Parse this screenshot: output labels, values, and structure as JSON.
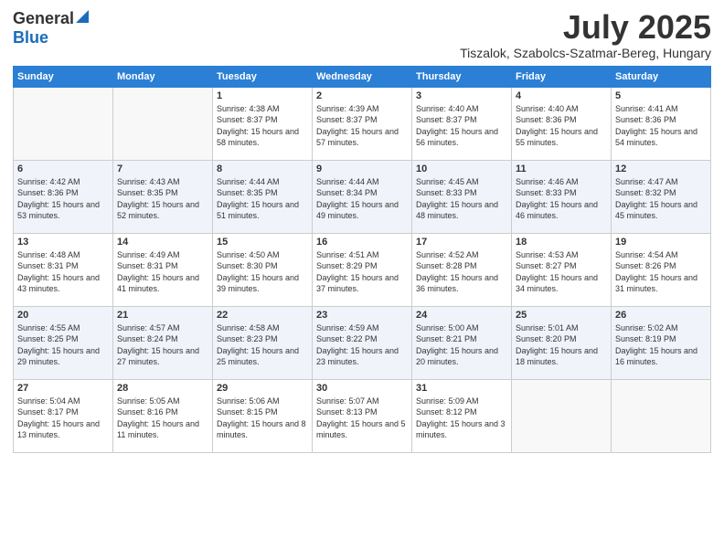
{
  "logo": {
    "general": "General",
    "blue": "Blue"
  },
  "title": "July 2025",
  "subtitle": "Tiszalok, Szabolcs-Szatmar-Bereg, Hungary",
  "headers": [
    "Sunday",
    "Monday",
    "Tuesday",
    "Wednesday",
    "Thursday",
    "Friday",
    "Saturday"
  ],
  "weeks": [
    [
      {
        "day": "",
        "info": ""
      },
      {
        "day": "",
        "info": ""
      },
      {
        "day": "1",
        "info": "Sunrise: 4:38 AM\nSunset: 8:37 PM\nDaylight: 15 hours and 58 minutes."
      },
      {
        "day": "2",
        "info": "Sunrise: 4:39 AM\nSunset: 8:37 PM\nDaylight: 15 hours and 57 minutes."
      },
      {
        "day": "3",
        "info": "Sunrise: 4:40 AM\nSunset: 8:37 PM\nDaylight: 15 hours and 56 minutes."
      },
      {
        "day": "4",
        "info": "Sunrise: 4:40 AM\nSunset: 8:36 PM\nDaylight: 15 hours and 55 minutes."
      },
      {
        "day": "5",
        "info": "Sunrise: 4:41 AM\nSunset: 8:36 PM\nDaylight: 15 hours and 54 minutes."
      }
    ],
    [
      {
        "day": "6",
        "info": "Sunrise: 4:42 AM\nSunset: 8:36 PM\nDaylight: 15 hours and 53 minutes."
      },
      {
        "day": "7",
        "info": "Sunrise: 4:43 AM\nSunset: 8:35 PM\nDaylight: 15 hours and 52 minutes."
      },
      {
        "day": "8",
        "info": "Sunrise: 4:44 AM\nSunset: 8:35 PM\nDaylight: 15 hours and 51 minutes."
      },
      {
        "day": "9",
        "info": "Sunrise: 4:44 AM\nSunset: 8:34 PM\nDaylight: 15 hours and 49 minutes."
      },
      {
        "day": "10",
        "info": "Sunrise: 4:45 AM\nSunset: 8:33 PM\nDaylight: 15 hours and 48 minutes."
      },
      {
        "day": "11",
        "info": "Sunrise: 4:46 AM\nSunset: 8:33 PM\nDaylight: 15 hours and 46 minutes."
      },
      {
        "day": "12",
        "info": "Sunrise: 4:47 AM\nSunset: 8:32 PM\nDaylight: 15 hours and 45 minutes."
      }
    ],
    [
      {
        "day": "13",
        "info": "Sunrise: 4:48 AM\nSunset: 8:31 PM\nDaylight: 15 hours and 43 minutes."
      },
      {
        "day": "14",
        "info": "Sunrise: 4:49 AM\nSunset: 8:31 PM\nDaylight: 15 hours and 41 minutes."
      },
      {
        "day": "15",
        "info": "Sunrise: 4:50 AM\nSunset: 8:30 PM\nDaylight: 15 hours and 39 minutes."
      },
      {
        "day": "16",
        "info": "Sunrise: 4:51 AM\nSunset: 8:29 PM\nDaylight: 15 hours and 37 minutes."
      },
      {
        "day": "17",
        "info": "Sunrise: 4:52 AM\nSunset: 8:28 PM\nDaylight: 15 hours and 36 minutes."
      },
      {
        "day": "18",
        "info": "Sunrise: 4:53 AM\nSunset: 8:27 PM\nDaylight: 15 hours and 34 minutes."
      },
      {
        "day": "19",
        "info": "Sunrise: 4:54 AM\nSunset: 8:26 PM\nDaylight: 15 hours and 31 minutes."
      }
    ],
    [
      {
        "day": "20",
        "info": "Sunrise: 4:55 AM\nSunset: 8:25 PM\nDaylight: 15 hours and 29 minutes."
      },
      {
        "day": "21",
        "info": "Sunrise: 4:57 AM\nSunset: 8:24 PM\nDaylight: 15 hours and 27 minutes."
      },
      {
        "day": "22",
        "info": "Sunrise: 4:58 AM\nSunset: 8:23 PM\nDaylight: 15 hours and 25 minutes."
      },
      {
        "day": "23",
        "info": "Sunrise: 4:59 AM\nSunset: 8:22 PM\nDaylight: 15 hours and 23 minutes."
      },
      {
        "day": "24",
        "info": "Sunrise: 5:00 AM\nSunset: 8:21 PM\nDaylight: 15 hours and 20 minutes."
      },
      {
        "day": "25",
        "info": "Sunrise: 5:01 AM\nSunset: 8:20 PM\nDaylight: 15 hours and 18 minutes."
      },
      {
        "day": "26",
        "info": "Sunrise: 5:02 AM\nSunset: 8:19 PM\nDaylight: 15 hours and 16 minutes."
      }
    ],
    [
      {
        "day": "27",
        "info": "Sunrise: 5:04 AM\nSunset: 8:17 PM\nDaylight: 15 hours and 13 minutes."
      },
      {
        "day": "28",
        "info": "Sunrise: 5:05 AM\nSunset: 8:16 PM\nDaylight: 15 hours and 11 minutes."
      },
      {
        "day": "29",
        "info": "Sunrise: 5:06 AM\nSunset: 8:15 PM\nDaylight: 15 hours and 8 minutes."
      },
      {
        "day": "30",
        "info": "Sunrise: 5:07 AM\nSunset: 8:13 PM\nDaylight: 15 hours and 5 minutes."
      },
      {
        "day": "31",
        "info": "Sunrise: 5:09 AM\nSunset: 8:12 PM\nDaylight: 15 hours and 3 minutes."
      },
      {
        "day": "",
        "info": ""
      },
      {
        "day": "",
        "info": ""
      }
    ]
  ]
}
